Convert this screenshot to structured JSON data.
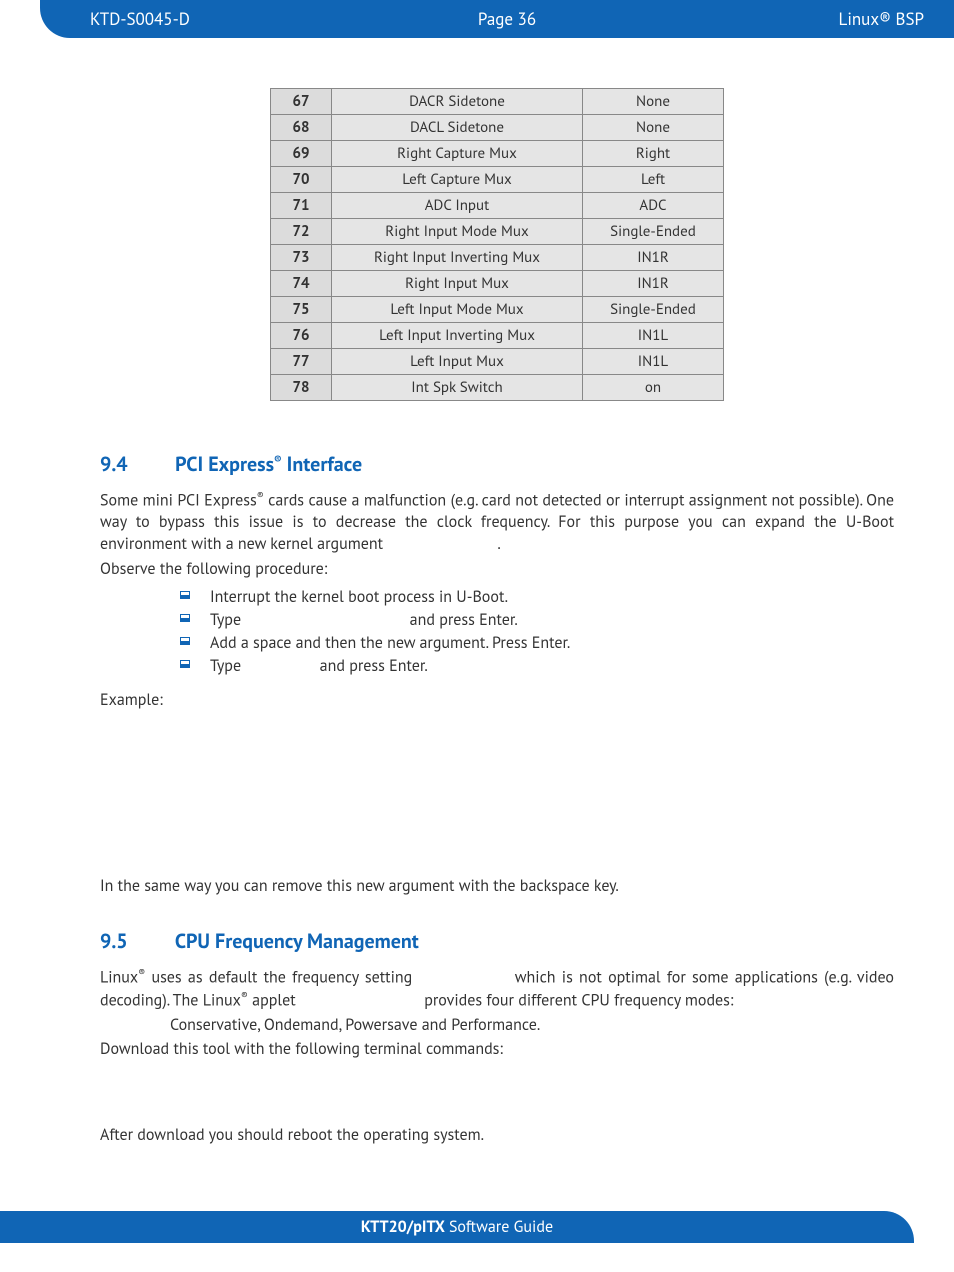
{
  "header": {
    "left": "KTD-S0045-D",
    "center": "Page 36",
    "right": "Linux® BSP"
  },
  "table_rows": [
    {
      "num": "67",
      "name": "DACR Sidetone",
      "val": "None"
    },
    {
      "num": "68",
      "name": "DACL Sidetone",
      "val": "None"
    },
    {
      "num": "69",
      "name": "Right Capture Mux",
      "val": "Right"
    },
    {
      "num": "70",
      "name": "Left Capture Mux",
      "val": "Left"
    },
    {
      "num": "71",
      "name": "ADC Input",
      "val": "ADC"
    },
    {
      "num": "72",
      "name": "Right Input Mode Mux",
      "val": "Single-Ended"
    },
    {
      "num": "73",
      "name": "Right Input Inverting Mux",
      "val": "IN1R"
    },
    {
      "num": "74",
      "name": "Right Input Mux",
      "val": "IN1R"
    },
    {
      "num": "75",
      "name": "Left Input Mode Mux",
      "val": "Single-Ended"
    },
    {
      "num": "76",
      "name": "Left Input Inverting Mux",
      "val": "IN1L"
    },
    {
      "num": "77",
      "name": "Left Input Mux",
      "val": "IN1L"
    },
    {
      "num": "78",
      "name": "Int Spk Switch",
      "val": "on"
    }
  ],
  "sec94": {
    "num": "9.4",
    "title_a": "PCI Express",
    "title_b": " Interface",
    "p1_a": "Some mini PCI Express",
    "p1_b": " cards cause a malfunction (e.g. card not detected or interrupt assignment not possible). One way to bypass this issue is to decrease the clock frequency. For this purpose you can expand the U-Boot environment with a new kernel argument",
    "p1_c": ".",
    "p2": "Observe the following procedure:",
    "li1": "Interrupt the kernel boot process in U-Boot.",
    "li2_a": "Type",
    "li2_b": "and press Enter.",
    "li3": "Add a space and then the new argument. Press Enter.",
    "li4_a": "Type",
    "li4_b": "and press Enter.",
    "example_label": "Example:",
    "p3": "In the same way you can remove this new argument with the backspace key."
  },
  "sec95": {
    "num": "9.5",
    "title": "CPU Frequency Management",
    "p1_a": "Linux",
    "p1_b": " uses as default the frequency setting",
    "p1_c": "which is not optimal for some applications (e.g. video decoding). The Linux",
    "p1_d": " applet",
    "p1_e": "provides four different CPU frequency modes:",
    "modes": "Conservative, Ondemand, Powersave and Performance.",
    "p2": "Download this tool with the following terminal commands:",
    "p3": "After download you should reboot the operating system."
  },
  "footer": {
    "bold": "KTT20/pITX",
    "rest": " Software Guide"
  }
}
